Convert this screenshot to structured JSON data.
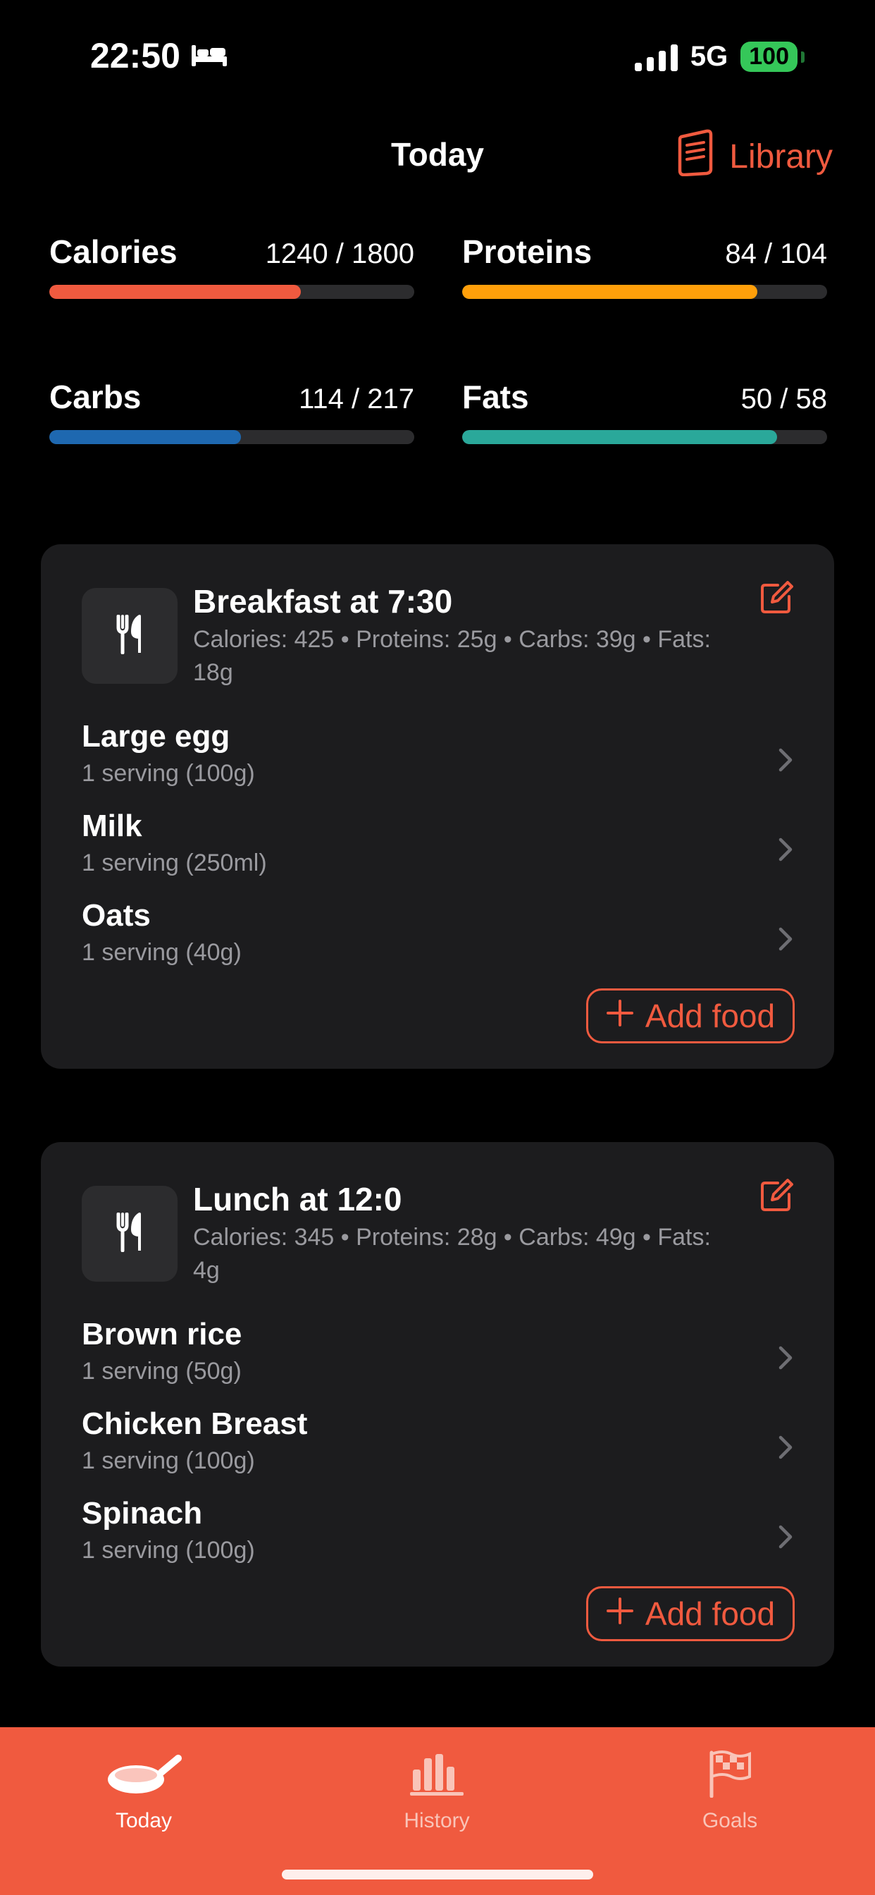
{
  "status": {
    "time": "22:50",
    "network": "5G",
    "battery": "100"
  },
  "nav": {
    "title": "Today",
    "library": "Library"
  },
  "macros": [
    {
      "label": "Calories",
      "value": "1240 / 1800",
      "progress": 0.689,
      "color": "#f05a3f"
    },
    {
      "label": "Proteins",
      "value": "84 / 104",
      "progress": 0.808,
      "color": "#ff9f0a"
    },
    {
      "label": "Carbs",
      "value": "114 / 217",
      "progress": 0.525,
      "color": "#1e68b0"
    },
    {
      "label": "Fats",
      "value": "50 / 58",
      "progress": 0.862,
      "color": "#2aa89a"
    }
  ],
  "meals": [
    {
      "title": "Breakfast at 7:30",
      "stats": "Calories: 425 • Proteins: 25g • Carbs: 39g • Fats: 18g",
      "foods": [
        {
          "name": "Large egg",
          "serving": "1 serving (100g)"
        },
        {
          "name": "Milk",
          "serving": "1 serving (250ml)"
        },
        {
          "name": "Oats",
          "serving": "1 serving (40g)"
        }
      ],
      "add_label": "Add food"
    },
    {
      "title": "Lunch at 12:0",
      "stats": "Calories: 345 • Proteins: 28g • Carbs: 49g • Fats: 4g",
      "foods": [
        {
          "name": "Brown rice",
          "serving": "1 serving (50g)"
        },
        {
          "name": "Chicken Breast",
          "serving": "1 serving (100g)"
        },
        {
          "name": "Spinach",
          "serving": "1 serving (100g)"
        }
      ],
      "add_label": "Add food"
    }
  ],
  "tabs": [
    {
      "label": "Today",
      "icon": "pan-icon",
      "active": true
    },
    {
      "label": "History",
      "icon": "bar-chart-icon",
      "active": false
    },
    {
      "label": "Goals",
      "icon": "flag-icon",
      "active": false
    }
  ],
  "colors": {
    "accent": "#f05a3f",
    "card": "#1c1c1e",
    "background": "#000000"
  }
}
